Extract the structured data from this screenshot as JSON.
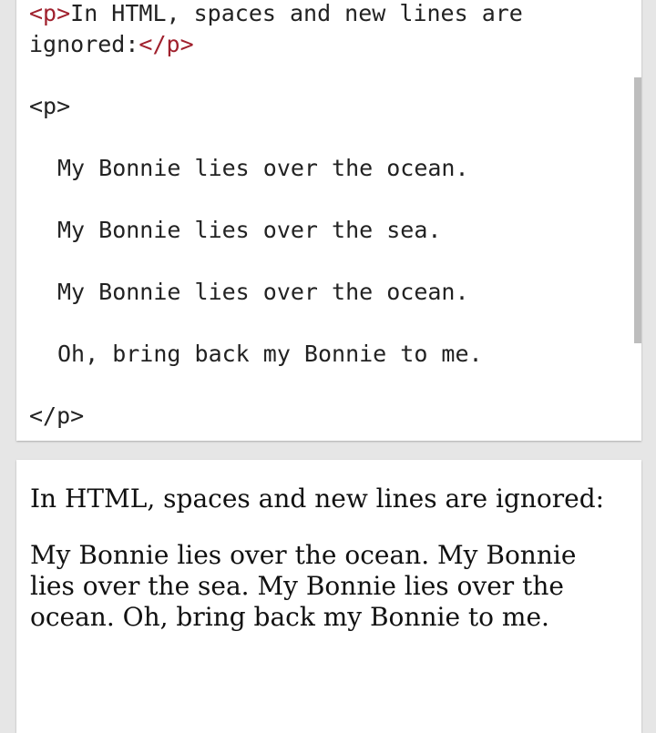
{
  "code_editor": {
    "line1_open_tag": "<p>",
    "line1_text": "In HTML, spaces and new lines are",
    "line2_text": "ignored:",
    "line2_close_tag": "</p>",
    "p_open_tag": "<p>",
    "verse_lines": [
      "My Bonnie lies over the ocean.",
      "My Bonnie lies over the sea.",
      "My Bonnie lies over the ocean.",
      "Oh, bring back my Bonnie to me."
    ],
    "p_close_tag": "</p>"
  },
  "result": {
    "paragraph1": "In HTML, spaces and new lines are ignored:",
    "paragraph2": "My Bonnie lies over the ocean. My Bonnie lies over the sea. My Bonnie lies over the ocean. Oh, bring back my Bonnie to me."
  },
  "colors": {
    "tag": "#a0202d",
    "text": "#222222",
    "scrollbar": "#bdbdbd"
  }
}
